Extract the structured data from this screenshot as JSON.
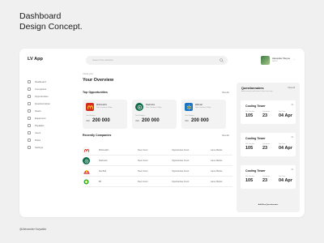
{
  "showcase": {
    "title_line1": "Dashboard",
    "title_line2": "Design Concept.",
    "credit": "@Alexander Kwyatkin"
  },
  "app": {
    "name": "LV App",
    "search_placeholder": "Search the website",
    "user": {
      "name": "Alexander Weyne",
      "role": "Admin"
    }
  },
  "colors": {
    "mcdonalds": "#d62b1e",
    "starbucks": "#0b6b46",
    "walmart": "#1b74c4",
    "accent": "#1b1b1b"
  },
  "sidebar": {
    "items": [
      {
        "label": "Dashboard",
        "icon": "grid-icon"
      },
      {
        "label": "Companies",
        "icon": "building-icon"
      },
      {
        "label": "Opportunities",
        "icon": "target-icon"
      },
      {
        "label": "Questionnaires",
        "icon": "list-icon"
      },
      {
        "label": "Fleets",
        "icon": "truck-icon"
      },
      {
        "label": "Equipment",
        "icon": "tool-icon"
      },
      {
        "label": "Payables",
        "icon": "card-icon"
      },
      {
        "label": "Users",
        "icon": "user-icon"
      },
      {
        "label": "Roles",
        "icon": "key-icon"
      },
      {
        "label": "Settings",
        "icon": "gear-icon"
      }
    ]
  },
  "main": {
    "greeting": "Check your",
    "title": "Your Overview",
    "top_opportunities": {
      "title": "Top Opportunities",
      "view_all": "View All",
      "cards": [
        {
          "name": "McDonald's",
          "sub": "Date Created: 04 Apr",
          "meta": "Total Budget",
          "currency": "USD",
          "amount": "200 000",
          "logo": "mcdonalds-logo"
        },
        {
          "name": "Starbucks",
          "sub": "Date Created: 04 Apr",
          "meta": "Total Budget",
          "currency": "USD",
          "amount": "200 000",
          "logo": "starbucks-logo"
        },
        {
          "name": "Walmart",
          "sub": "Date Created: 04 Apr",
          "meta": "Total Budget",
          "currency": "USD",
          "amount": "200 000",
          "logo": "walmart-logo"
        }
      ]
    },
    "recent_companies": {
      "title": "Recently Companies",
      "view_all": "View All",
      "rows": [
        {
          "name": "McDonald's",
          "fleets": "Fleet Count",
          "opps": "Opportunities Count",
          "owner": "Lance Mahler",
          "logo": "mcdonalds-logo"
        },
        {
          "name": "Starbucks",
          "fleets": "Fleet Count",
          "opps": "Opportunities Count",
          "owner": "Lance Mahler",
          "logo": "starbucks-logo"
        },
        {
          "name": "Red Bull",
          "fleets": "Fleet Count",
          "opps": "Opportunities Count",
          "owner": "Lance Mahler",
          "logo": "redbull-logo"
        },
        {
          "name": "BP",
          "fleets": "Fleet Count",
          "opps": "Opportunities Count",
          "owner": "Lance Mahler",
          "logo": "bp-logo"
        }
      ]
    }
  },
  "questionnaires": {
    "title": "Questionnaires",
    "subtitle": "Add answers and move to the next step",
    "view_all": "View All",
    "footer": "Add New Questionnaire",
    "cards": [
      {
        "title": "Cooling Tower",
        "label1": "Ref. Number",
        "val1": "105",
        "label2": "Questions",
        "val2": "23",
        "label3": "Due Date",
        "val3": "04 Apr"
      },
      {
        "title": "Cooling Tower",
        "label1": "Ref. Number",
        "val1": "105",
        "label2": "Questions",
        "val2": "23",
        "label3": "Due Date",
        "val3": "04 Apr"
      },
      {
        "title": "Cooling Tower",
        "label1": "Ref. Number",
        "val1": "105",
        "label2": "Questions",
        "val2": "23",
        "label3": "Due Date",
        "val3": "04 Apr"
      }
    ]
  }
}
